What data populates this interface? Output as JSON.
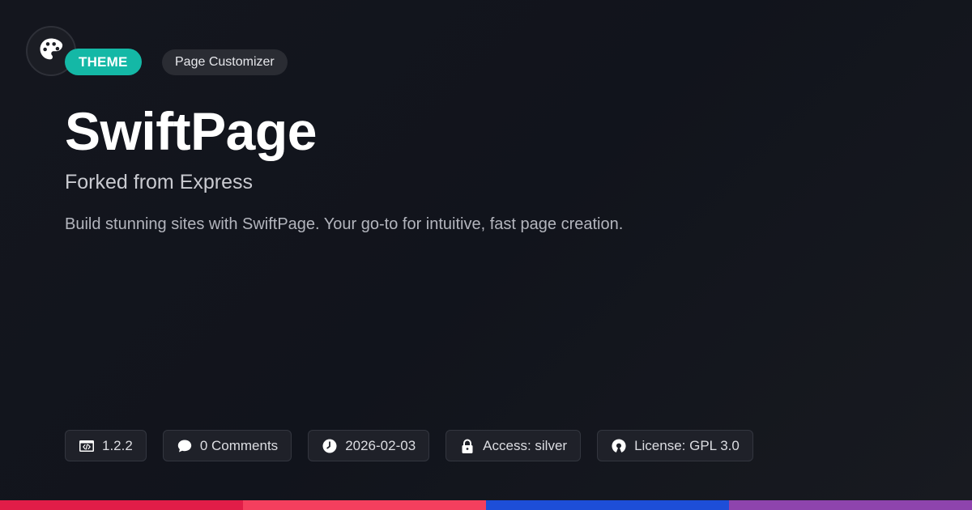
{
  "header": {
    "logo_icon": "palette-icon",
    "type_badge": "THEME",
    "category_badge": "Page Customizer"
  },
  "main": {
    "title": "SwiftPage",
    "subtitle": "Forked from Express",
    "description": "Build stunning sites with SwiftPage. Your go-to for intuitive, fast page creation."
  },
  "meta": {
    "version": "1.2.2",
    "comments": "0 Comments",
    "date": "2026-02-03",
    "access": "Access: silver",
    "license": "License: GPL 3.0"
  },
  "meta_icons": [
    "code-icon",
    "comment-icon",
    "clock-icon",
    "lock-icon",
    "open-source-icon"
  ],
  "colors": {
    "theme_badge": "#14b8a6",
    "stripe": [
      "#e11d48",
      "#f43f5e",
      "#1d4ed8",
      "#8e44ad"
    ]
  }
}
